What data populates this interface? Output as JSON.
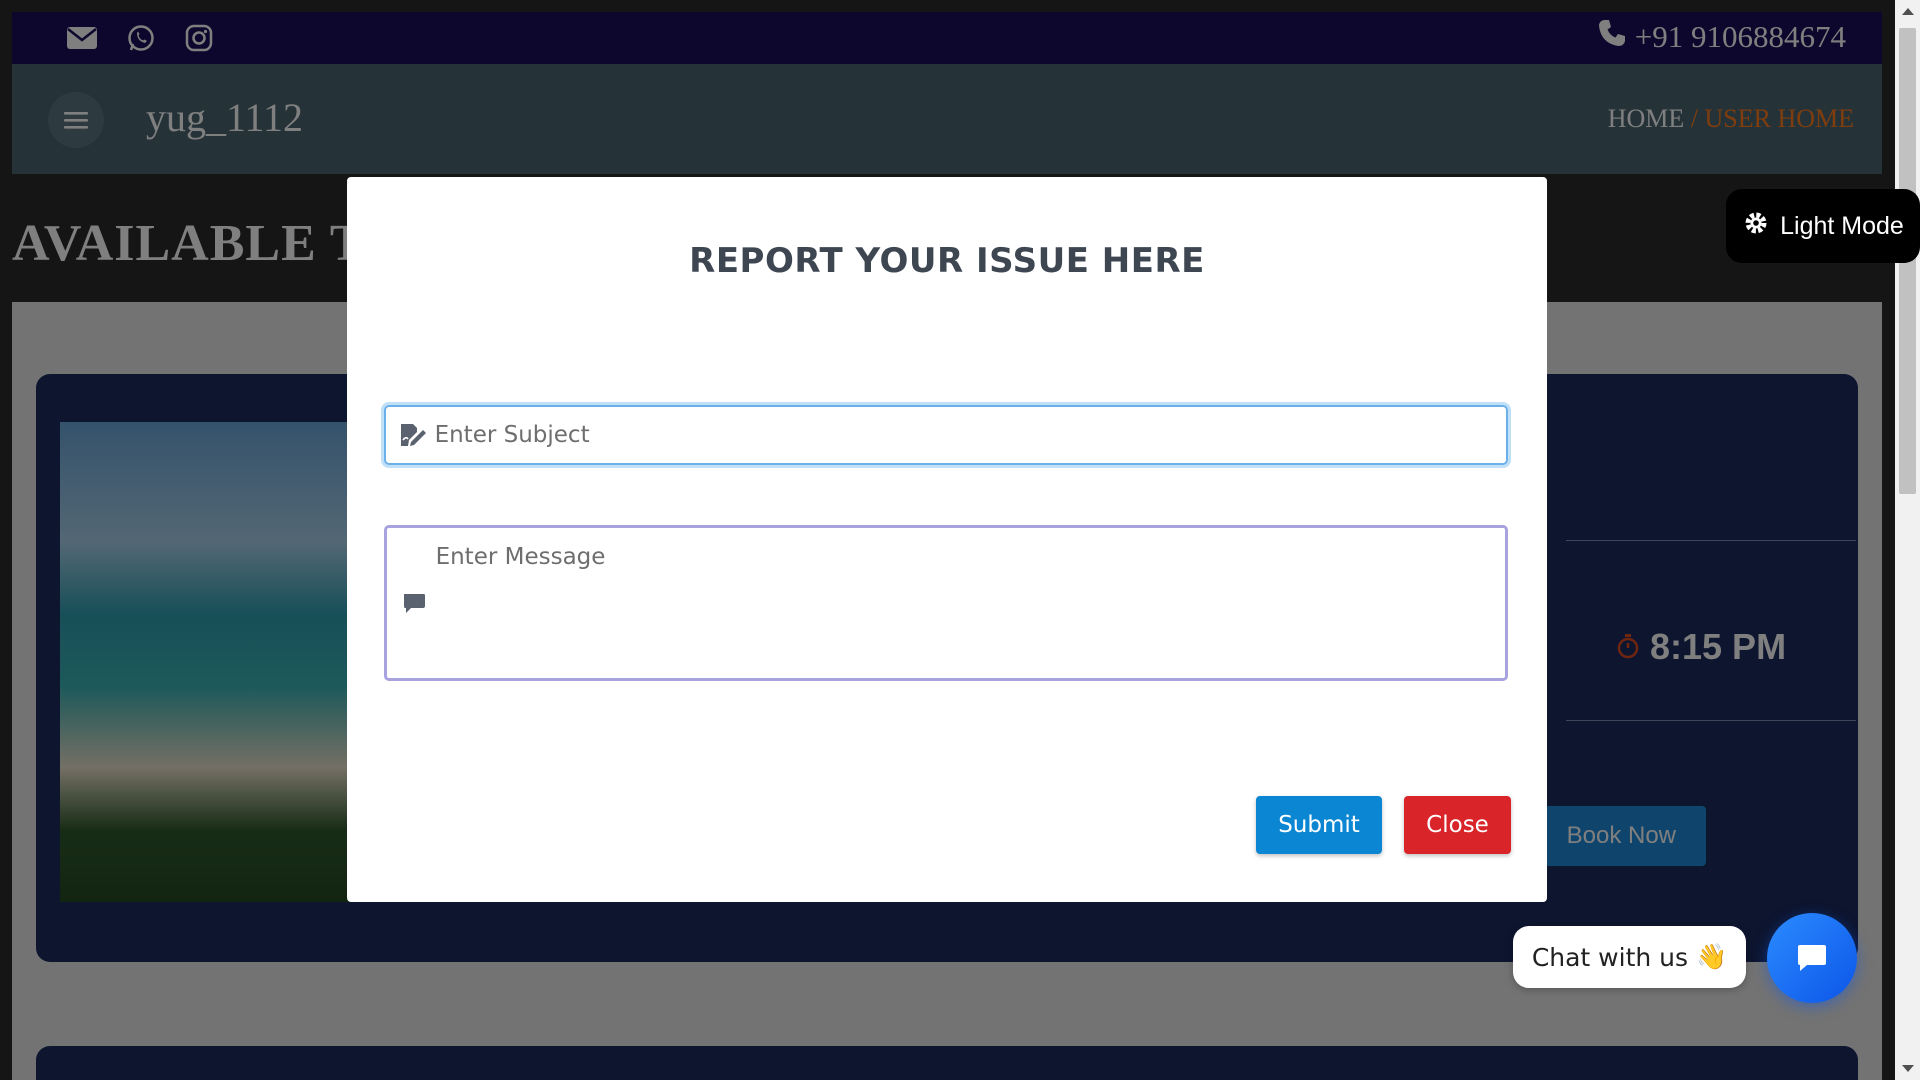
{
  "topbar": {
    "phone": "+91 9106884674",
    "icons": [
      "envelope-icon",
      "whatsapp-icon",
      "instagram-icon",
      "phone-icon"
    ]
  },
  "navbar": {
    "username": "yug_1112",
    "breadcrumb_home": "HOME",
    "breadcrumb_separator": " / ",
    "breadcrumb_current": "USER HOME"
  },
  "page": {
    "section_title": "AVAILABLE TOURS",
    "light_mode_label": "Light Mode",
    "tour_time": "8:15 PM",
    "book_label": "Book Now"
  },
  "modal": {
    "title": "REPORT YOUR ISSUE HERE",
    "subject_placeholder": "Enter Subject",
    "message_placeholder": "Enter Message",
    "submit_label": "Submit",
    "close_label": "Close"
  },
  "chat": {
    "label": "Chat with us",
    "emoji": "👋"
  },
  "colors": {
    "topbar": "#1c0f5a",
    "navbar": "#4a6772",
    "accent_orange": "#ff7a1a",
    "submit_blue": "#0b86d2",
    "close_red": "#d9252a",
    "chat_blue": "#1570f0"
  }
}
